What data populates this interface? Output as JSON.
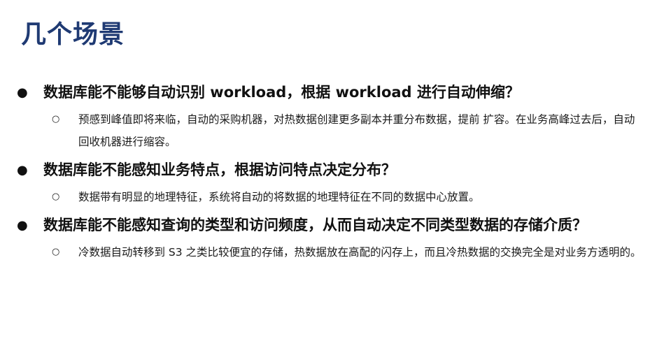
{
  "title": "几个场景",
  "bullet_main": "●",
  "bullet_sub": "○",
  "items": [
    {
      "text": "数据库能不能够自动识别 workload，根据 workload 进行自动伸缩？",
      "sub": "预感到峰值即将来临，自动的采购机器，对热数据创建更多副本并重分布数据，提前 扩容。在业务高峰过去后，自动回收机器进行缩容。"
    },
    {
      "text": "数据库能不能感知业务特点，根据访问特点决定分布？",
      "sub": "数据带有明显的地理特征，系统将自动的将数据的地理特征在不同的数据中心放置。"
    },
    {
      "text": "数据库能不能感知查询的类型和访问频度，从而自动决定不同类型数据的存储介质？",
      "sub": "冷数据自动转移到 S3 之类比较便宜的存储，热数据放在高配的闪存上，而且冷热数据的交换完全是对业务方透明的。"
    }
  ]
}
